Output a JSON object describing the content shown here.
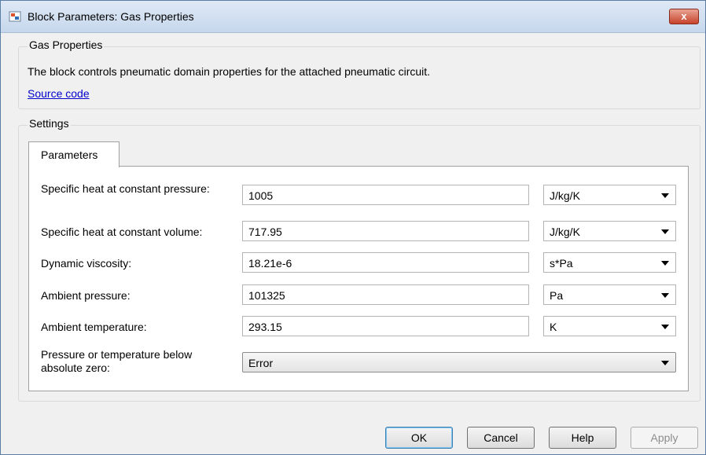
{
  "window": {
    "title": "Block Parameters: Gas Properties",
    "close_label": "x"
  },
  "description_group": {
    "title": "Gas Properties",
    "text": "The block controls pneumatic domain properties for the attached pneumatic circuit.",
    "link": "Source code"
  },
  "settings_group": {
    "title": "Settings",
    "tab": "Parameters"
  },
  "params": [
    {
      "label": "Specific heat at constant pressure:",
      "value": "1005",
      "unit": "J/kg/K"
    },
    {
      "label": "Specific heat at constant volume:",
      "value": "717.95",
      "unit": "J/kg/K"
    },
    {
      "label": "Dynamic viscosity:",
      "value": "18.21e-6",
      "unit": "s*Pa"
    },
    {
      "label": "Ambient pressure:",
      "value": "101325",
      "unit": "Pa"
    },
    {
      "label": "Ambient temperature:",
      "value": "293.15",
      "unit": "K"
    },
    {
      "label": "Pressure or temperature below absolute zero:",
      "value": "Error"
    }
  ],
  "buttons": {
    "ok": "OK",
    "cancel": "Cancel",
    "help": "Help",
    "apply": "Apply"
  }
}
